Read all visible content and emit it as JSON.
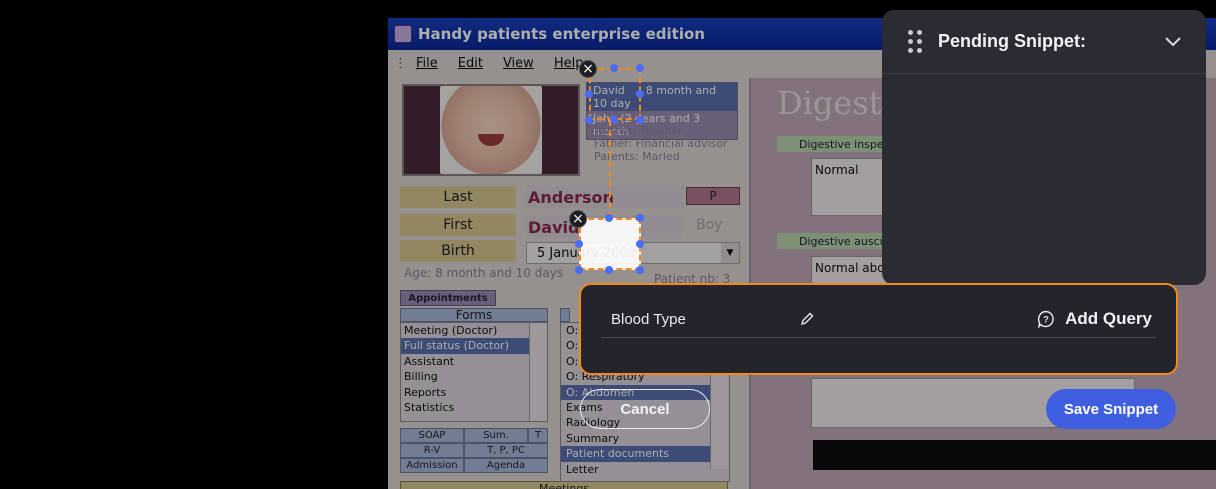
{
  "app": {
    "title": "Handy patients enterprise edition",
    "menu": [
      "File",
      "Edit",
      "View",
      "Help"
    ],
    "patient_list": [
      {
        "name": "David",
        "desc": "8 month and 10 day"
      },
      {
        "name": "John  (2",
        "desc": "years and 3 month"
      }
    ],
    "family": [
      "Mother: Teacher",
      "Father: Financial advisor",
      "Parents: Maried"
    ],
    "fields": {
      "last_label": "Last",
      "last_value": "Anderson",
      "p_button": "P",
      "first_label": "First",
      "first_value": "David",
      "gender": "Boy",
      "birth_label": "Birth",
      "birth_value": "5   January   2009"
    },
    "age": "Age: 8 month and 10 days",
    "patient_no": "Patient nb: 3",
    "appointments_label": "Appointments",
    "forms_title": "Forms",
    "forms": [
      "Meeting (Doctor)",
      "Full status (Doctor)",
      "Assistant",
      "Billing",
      "Reports",
      "Statistics"
    ],
    "forms_selected": "Full status (Doctor)",
    "sections": [
      "O:",
      "O:",
      "O:",
      "O: Respiratory",
      "O: Abdomen",
      "Exams",
      "Radiology",
      "Summary",
      "Patient documents",
      "Letter"
    ],
    "buttons": [
      [
        "SOAP",
        "Sum.",
        "T"
      ],
      [
        "R-V",
        "T, P, PC"
      ],
      [
        "Admission",
        "Agenda"
      ]
    ],
    "meetings_label": "Meetings",
    "right": {
      "title": "Digestive",
      "inspection_label": "Digestive inspec",
      "inspection_value": "Normal",
      "auscult_label": "Digestive auscult",
      "auscult_value": "Normal abdo"
    }
  },
  "overlay": {
    "pending_title": "Pending Snippet:",
    "field_label": "Blood Type",
    "add_query_label": "Add Query",
    "cancel_label": "Cancel",
    "save_label": "Save Snippet",
    "close_glyph": "×"
  },
  "colors": {
    "accent_orange": "#f28a1b",
    "handle_blue": "#4a6cf7",
    "save_blue": "#3f5fe0",
    "panel_dark": "#2b2b33"
  }
}
